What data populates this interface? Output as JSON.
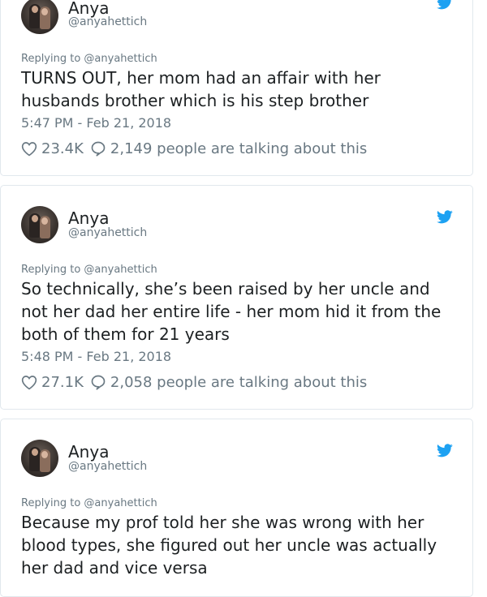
{
  "accent_color": "#1da1f2",
  "icons": {
    "brand": "twitter-bird-icon",
    "like": "heart-icon",
    "reply": "speech-bubble-icon"
  },
  "tweets": [
    {
      "author_name": "Anya",
      "author_handle": "@anyahettich",
      "reply_context": "Replying to @anyahettich",
      "text": "TURNS OUT, her mom had an affair with her husbands brother which is his step brother",
      "timestamp": "5:47 PM - Feb 21, 2018",
      "likes": "23.4K",
      "talking": "2,149 people are talking about this"
    },
    {
      "author_name": "Anya",
      "author_handle": "@anyahettich",
      "reply_context": "Replying to @anyahettich",
      "text": "So technically, she’s been raised by her uncle and not her dad her entire life - her mom hid it from the both of them for 21 years",
      "timestamp": "5:48 PM - Feb 21, 2018",
      "likes": "27.1K",
      "talking": "2,058 people are talking about this"
    },
    {
      "author_name": "Anya",
      "author_handle": "@anyahettich",
      "reply_context": "Replying to @anyahettich",
      "text": "Because my prof told her she was wrong with her blood types, she figured out her uncle was actually her dad and vice versa"
    }
  ]
}
